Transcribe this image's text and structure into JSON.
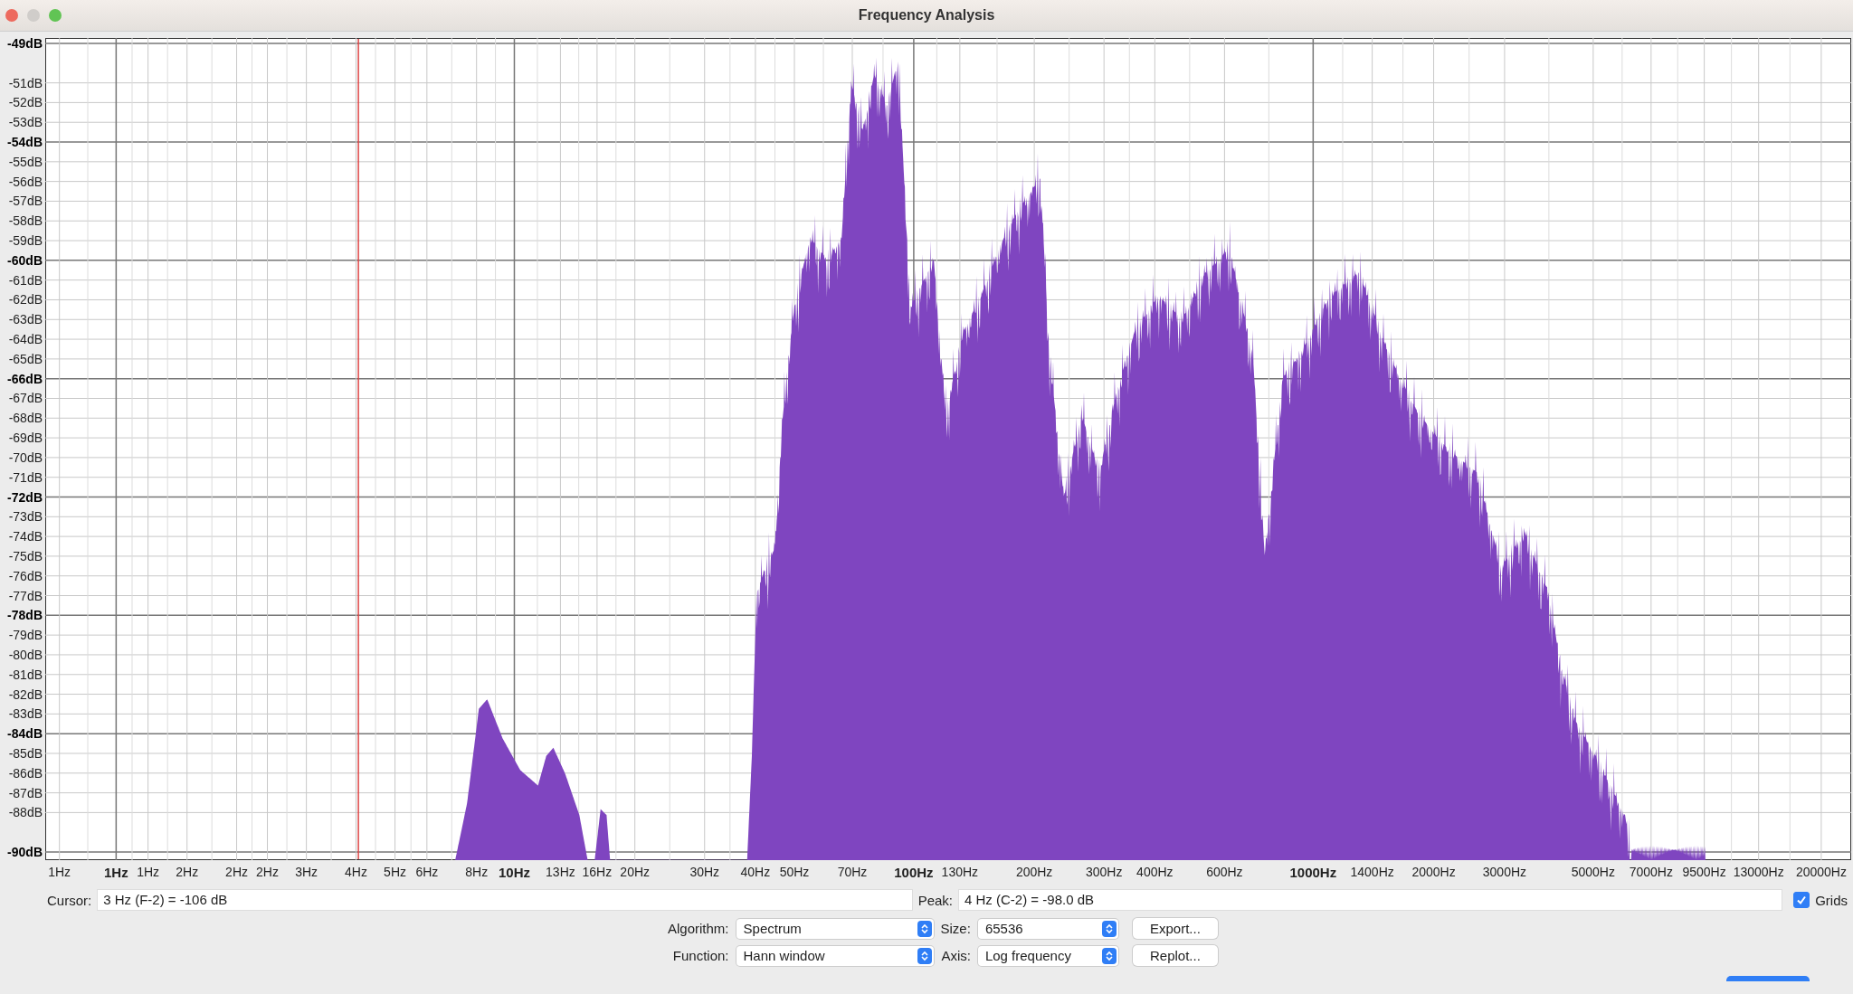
{
  "window": {
    "title": "Frequency Analysis"
  },
  "y_axis": [
    {
      "label": "-49dB",
      "major": true
    },
    {
      "label": "-51dB",
      "major": false
    },
    {
      "label": "-52dB",
      "major": false
    },
    {
      "label": "-53dB",
      "major": false
    },
    {
      "label": "-54dB",
      "major": true
    },
    {
      "label": "-55dB",
      "major": false
    },
    {
      "label": "-56dB",
      "major": false
    },
    {
      "label": "-57dB",
      "major": false
    },
    {
      "label": "-58dB",
      "major": false
    },
    {
      "label": "-59dB",
      "major": false
    },
    {
      "label": "-60dB",
      "major": true
    },
    {
      "label": "-61dB",
      "major": false
    },
    {
      "label": "-62dB",
      "major": false
    },
    {
      "label": "-63dB",
      "major": false
    },
    {
      "label": "-64dB",
      "major": false
    },
    {
      "label": "-65dB",
      "major": false
    },
    {
      "label": "-66dB",
      "major": true
    },
    {
      "label": "-67dB",
      "major": false
    },
    {
      "label": "-68dB",
      "major": false
    },
    {
      "label": "-69dB",
      "major": false
    },
    {
      "label": "-70dB",
      "major": false
    },
    {
      "label": "-71dB",
      "major": false
    },
    {
      "label": "-72dB",
      "major": true
    },
    {
      "label": "-73dB",
      "major": false
    },
    {
      "label": "-74dB",
      "major": false
    },
    {
      "label": "-75dB",
      "major": false
    },
    {
      "label": "-76dB",
      "major": false
    },
    {
      "label": "-77dB",
      "major": false
    },
    {
      "label": "-78dB",
      "major": true
    },
    {
      "label": "-79dB",
      "major": false
    },
    {
      "label": "-80dB",
      "major": false
    },
    {
      "label": "-81dB",
      "major": false
    },
    {
      "label": "-82dB",
      "major": false
    },
    {
      "label": "-83dB",
      "major": false
    },
    {
      "label": "-84dB",
      "major": true
    },
    {
      "label": "-85dB",
      "major": false
    },
    {
      "label": "-86dB",
      "major": false
    },
    {
      "label": "-87dB",
      "major": false
    },
    {
      "label": "-88dB",
      "major": false
    },
    {
      "label": "-90dB",
      "major": true
    }
  ],
  "x_axis": [
    {
      "label": "1Hz",
      "major": false
    },
    {
      "label": "1Hz",
      "major": true
    },
    {
      "label": "1Hz",
      "major": false
    },
    {
      "label": "2Hz",
      "major": false
    },
    {
      "label": "2Hz",
      "major": false
    },
    {
      "label": "2Hz",
      "major": false
    },
    {
      "label": "3Hz",
      "major": false
    },
    {
      "label": "4Hz",
      "major": false
    },
    {
      "label": "5Hz",
      "major": false
    },
    {
      "label": "6Hz",
      "major": false
    },
    {
      "label": "8Hz",
      "major": false
    },
    {
      "label": "10Hz",
      "major": true
    },
    {
      "label": "13Hz",
      "major": false
    },
    {
      "label": "16Hz",
      "major": false
    },
    {
      "label": "20Hz",
      "major": false
    },
    {
      "label": "30Hz",
      "major": false
    },
    {
      "label": "40Hz",
      "major": false
    },
    {
      "label": "50Hz",
      "major": false
    },
    {
      "label": "70Hz",
      "major": false
    },
    {
      "label": "100Hz",
      "major": true
    },
    {
      "label": "130Hz",
      "major": false
    },
    {
      "label": "200Hz",
      "major": false
    },
    {
      "label": "300Hz",
      "major": false
    },
    {
      "label": "400Hz",
      "major": false
    },
    {
      "label": "600Hz",
      "major": false
    },
    {
      "label": "1000Hz",
      "major": true
    },
    {
      "label": "1400Hz",
      "major": false
    },
    {
      "label": "2000Hz",
      "major": false
    },
    {
      "label": "3000Hz",
      "major": false
    },
    {
      "label": "5000Hz",
      "major": false
    },
    {
      "label": "7000Hz",
      "major": false
    },
    {
      "label": "9500Hz",
      "major": false
    },
    {
      "label": "13000Hz",
      "major": false
    },
    {
      "label": "20000Hz",
      "major": false
    }
  ],
  "cursor": {
    "label": "Cursor:",
    "value": "3 Hz (F-2) = -106 dB"
  },
  "peak": {
    "label": "Peak:",
    "value": "4 Hz (C-2) = -98.0 dB"
  },
  "grids": {
    "label": "Grids",
    "checked": true
  },
  "algorithm": {
    "label": "Algorithm:",
    "value": "Spectrum"
  },
  "size": {
    "label": "Size:",
    "value": "65536"
  },
  "function": {
    "label": "Function:",
    "value": "Hann window"
  },
  "axis": {
    "label": "Axis:",
    "value": "Log frequency"
  },
  "buttons": {
    "export": "Export...",
    "replot": "Replot..."
  }
}
